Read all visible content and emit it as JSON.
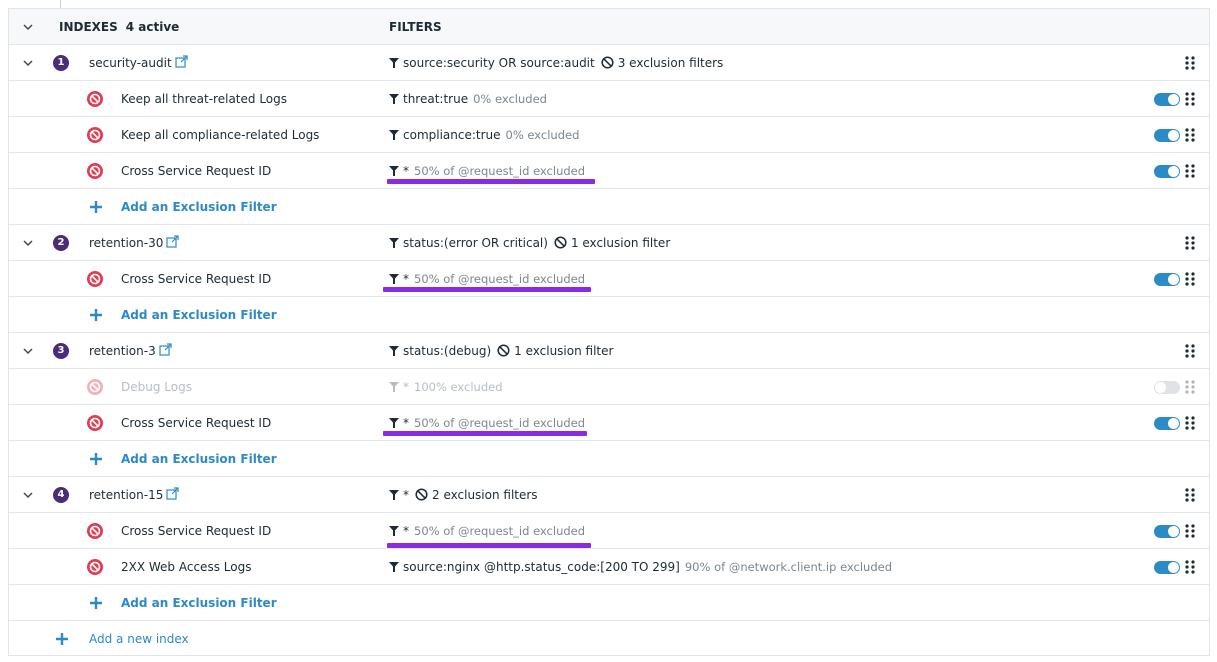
{
  "colors": {
    "accent": "#2c8ac7",
    "badge": "#4a2c7a",
    "block": "#e03e52",
    "highlight": "#8a2be2"
  },
  "header": {
    "indexes_label": "INDEXES",
    "count_label": "4 active",
    "filters_label": "FILTERS"
  },
  "indexes": [
    {
      "number": "1",
      "name": "security-audit",
      "filter": "source:security OR source:audit",
      "exclusion_count": "3 exclusion filters",
      "exclusions": [
        {
          "name": "Keep all threat-related Logs",
          "query": "threat:true",
          "detail": "0% excluded",
          "enabled": true
        },
        {
          "name": "Keep all compliance-related Logs",
          "query": "compliance:true",
          "detail": "0% excluded",
          "enabled": true
        },
        {
          "name": "Cross Service Request ID",
          "query": "*",
          "detail": "50% of @request_id excluded",
          "enabled": true
        }
      ],
      "add_label": "Add an Exclusion Filter"
    },
    {
      "number": "2",
      "name": "retention-30",
      "filter": "status:(error OR critical)",
      "exclusion_count": "1 exclusion filter",
      "exclusions": [
        {
          "name": "Cross Service Request ID",
          "query": "*",
          "detail": "50% of @request_id excluded",
          "enabled": true
        }
      ],
      "add_label": "Add an Exclusion Filter"
    },
    {
      "number": "3",
      "name": "retention-3",
      "filter": "status:(debug)",
      "exclusion_count": "1 exclusion filter",
      "exclusions": [
        {
          "name": "Debug Logs",
          "query": "*",
          "detail": "100% excluded",
          "enabled": false
        },
        {
          "name": "Cross Service Request ID",
          "query": "*",
          "detail": "50% of @request_id excluded",
          "enabled": true
        }
      ],
      "add_label": "Add an Exclusion Filter"
    },
    {
      "number": "4",
      "name": "retention-15",
      "filter": "*",
      "exclusion_count": "2 exclusion filters",
      "exclusions": [
        {
          "name": "Cross Service Request ID",
          "query": "*",
          "detail": "50% of @request_id excluded",
          "enabled": true
        },
        {
          "name": "2XX Web Access Logs",
          "query": "source:nginx @http.status_code:[200 TO 299]",
          "detail": "90% of @network.client.ip excluded",
          "enabled": true
        }
      ],
      "add_label": "Add an Exclusion Filter"
    }
  ],
  "footer": {
    "add_index_label": "Add a new index"
  }
}
